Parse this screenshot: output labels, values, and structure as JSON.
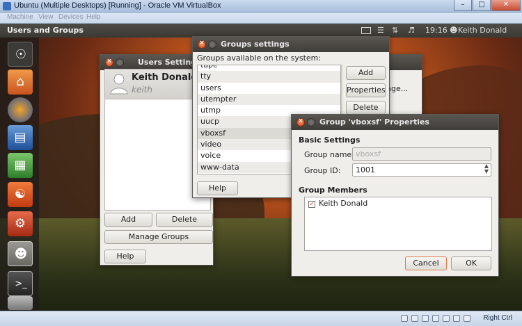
{
  "host": {
    "title": "Ubuntu (Multiple Desktops) [Running] - Oracle VM VirtualBox",
    "window_buttons": [
      "–",
      "□",
      "✕"
    ],
    "menu": [
      "Machine",
      "View",
      "Devices",
      "Help"
    ],
    "status_host_key": "Right Ctrl"
  },
  "panel": {
    "app_title": "Users and Groups",
    "time": "19:16",
    "user": "Keith Donald",
    "icons": [
      "mail-icon",
      "network-icon",
      "volume-icon",
      "user-icon"
    ]
  },
  "launcher": {
    "items": [
      "ubuntu-logo-icon",
      "home-folder-icon",
      "firefox-icon",
      "writer-icon",
      "calc-icon",
      "software-center-icon",
      "system-settings-icon",
      "users-groups-icon",
      "terminal-icon",
      "hard-drive-icon"
    ]
  },
  "users_settings": {
    "title": "Users Settings",
    "user_name": "Keith Donald",
    "user_login": "keith",
    "add_label": "Add",
    "delete_label": "Delete",
    "manage_groups_label": "Manage Groups",
    "help_label": "Help",
    "partial_text": "nge..."
  },
  "groups_settings": {
    "title": "Groups settings",
    "available_label": "Groups available on the system:",
    "groups": [
      "tape",
      "tty",
      "users",
      "utempter",
      "utmp",
      "uucp",
      "vboxsf",
      "video",
      "voice",
      "www-data"
    ],
    "selected_group": "vboxsf",
    "add_label": "Add",
    "properties_label": "Properties",
    "delete_label": "Delete",
    "help_label": "Help"
  },
  "group_properties": {
    "title": "Group 'vboxsf' Properties",
    "basic_settings_label": "Basic Settings",
    "group_name_label": "Group name:",
    "group_name_value": "vboxsf",
    "group_id_label": "Group ID:",
    "group_id_value": "1001",
    "group_members_label": "Group Members",
    "members": [
      {
        "name": "Keith Donald",
        "checked": true
      }
    ],
    "cancel_label": "Cancel",
    "ok_label": "OK"
  }
}
